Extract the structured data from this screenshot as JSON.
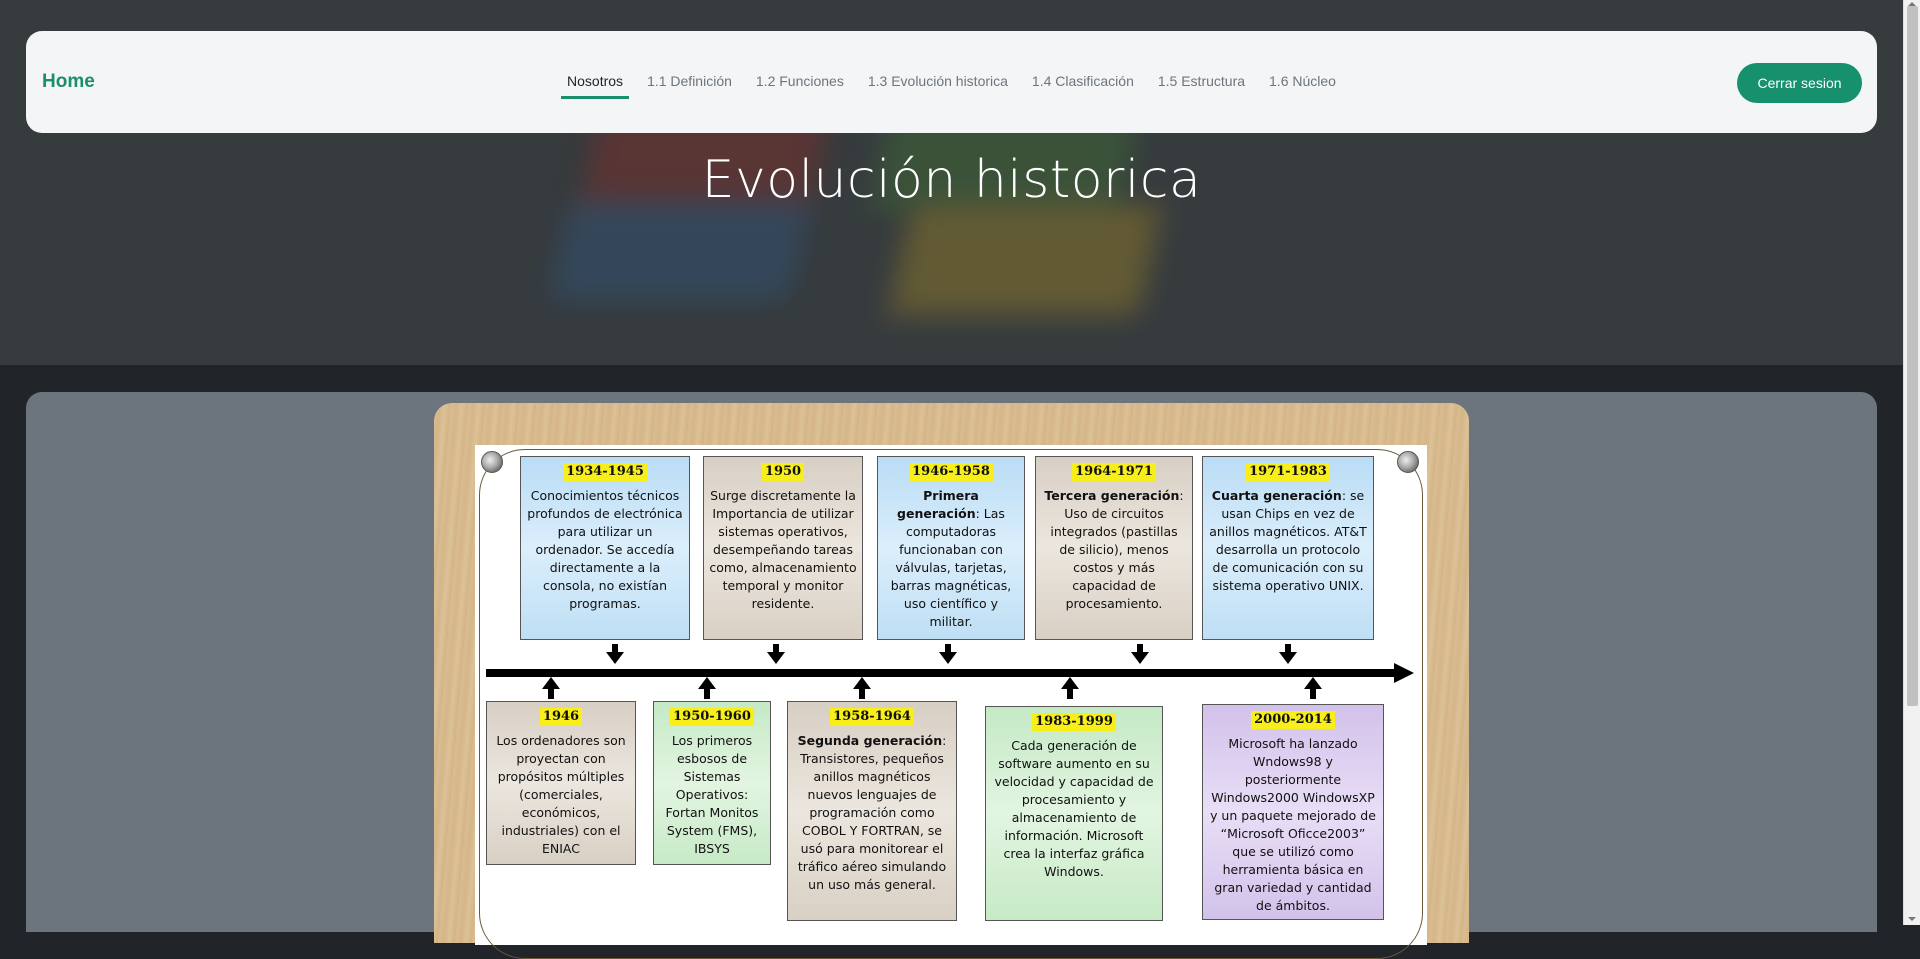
{
  "hero": {
    "title": "Evolución historica"
  },
  "navbar": {
    "brand": "Home",
    "links": [
      {
        "label": "Nosotros",
        "active": true
      },
      {
        "label": "1.1 Definición"
      },
      {
        "label": "1.2 Funciones"
      },
      {
        "label": "1.3 Evolución historica"
      },
      {
        "label": "1.4 Clasificación"
      },
      {
        "label": "1.5 Estructura"
      },
      {
        "label": "1.6 Núcleo"
      }
    ],
    "logout": "Cerrar sesion",
    "accent_color": "#16906d"
  },
  "timeline": {
    "top": [
      {
        "year": "1934-1945",
        "text": "Conocimientos técnicos profundos de electrónica para utilizar un ordenador. Se accedía directamente a la consola, no existían programas.",
        "color": "blue"
      },
      {
        "year": "1950",
        "text": "Surge discretamente la Importancia de utilizar sistemas operativos, desempeñando tareas como, almacenamiento temporal y monitor residente.",
        "color": "beige"
      },
      {
        "year": "1946-1958",
        "bold": "Primera generación",
        "text": ": Las computadoras funcionaban con válvulas, tarjetas, barras magnéticas, uso científico y militar.",
        "color": "blue"
      },
      {
        "year": "1964-1971",
        "bold": "Tercera generación",
        "text": ": Uso de circuitos integrados (pastillas de silicio), menos costos y más capacidad de procesamiento.",
        "color": "beige"
      },
      {
        "year": "1971-1983",
        "bold": "Cuarta generación",
        "text": ": se usan Chips en vez de anillos magnéticos. AT&T desarrolla un protocolo de comunicación con su sistema operativo UNIX.",
        "color": "blue"
      }
    ],
    "bottom": [
      {
        "year": "1946",
        "text": "Los ordenadores son proyectan con propósitos múltiples (comerciales, económicos, industriales) con el ENIAC",
        "color": "beige"
      },
      {
        "year": "1950-1960",
        "text": "Los primeros esbosos de Sistemas Operativos: Fortan Monitos System (FMS), IBSYS",
        "color": "green"
      },
      {
        "year": "1958-1964",
        "bold": "Segunda generación",
        "text": ": Transistores, pequeños anillos magnéticos nuevos lenguajes de programación como COBOL Y FORTRAN, se usó para monitorear el tráfico aéreo simulando un uso más general.",
        "color": "beige"
      },
      {
        "year": "1983-1999",
        "text": "Cada generación de software aumento en su velocidad y capacidad de procesamiento y almacenamiento de información. Microsoft crea la interfaz gráfica Windows.",
        "color": "green"
      },
      {
        "year": "2000-2014",
        "text": "Microsoft ha lanzado Wndows98 y posteriormente Windows2000 WindowsXP y un paquete mejorado de “Microsoft Oficce2003” que se utilizó como herramienta básica en gran variedad y cantidad de ámbitos.",
        "color": "purple"
      }
    ]
  }
}
